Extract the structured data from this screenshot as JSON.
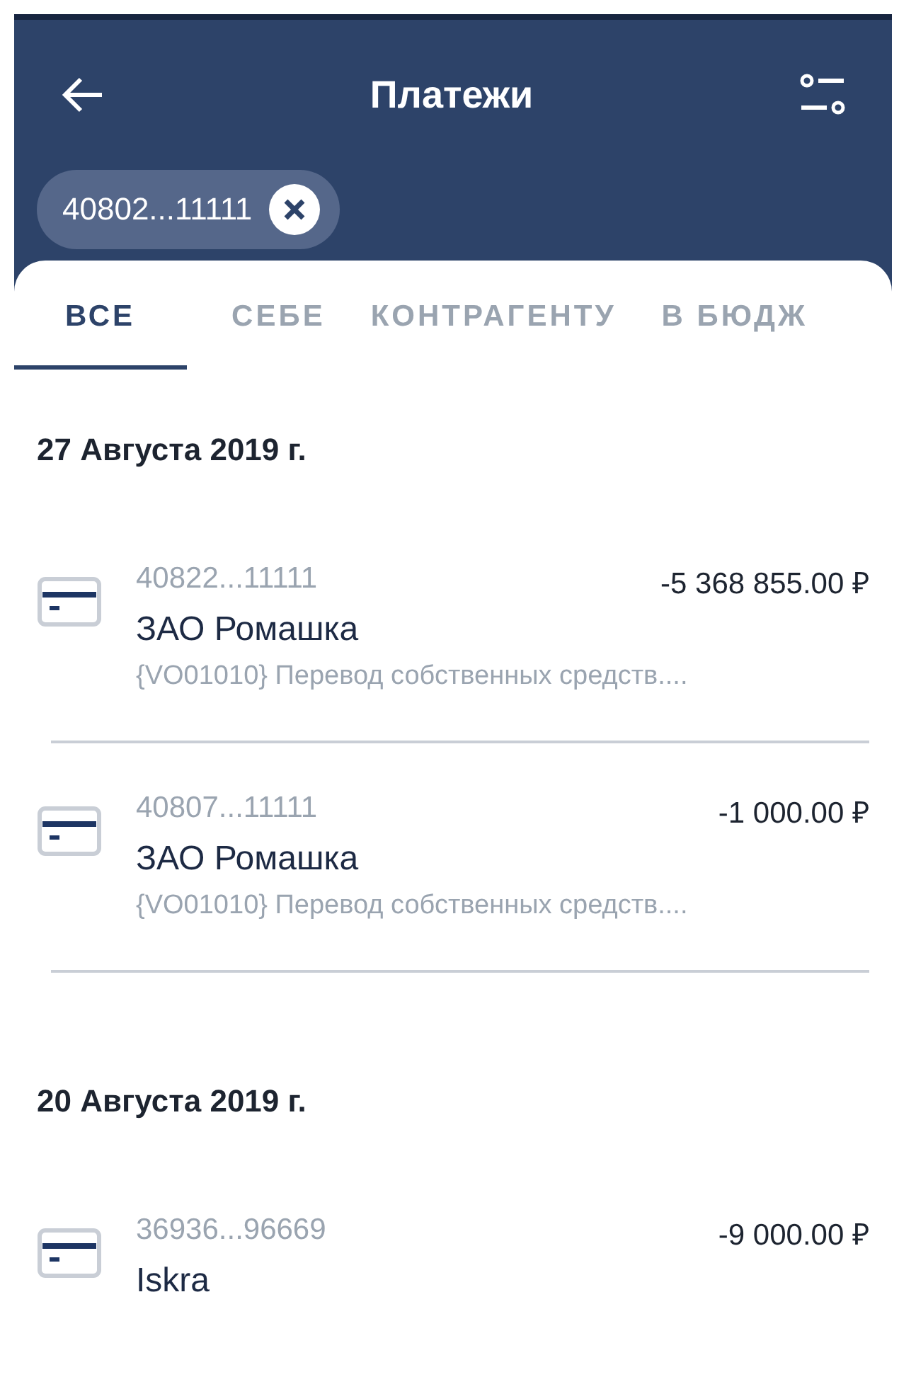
{
  "header": {
    "title": "Платежи"
  },
  "filter_chip": {
    "label": "40802...11111"
  },
  "tabs": [
    {
      "label": "ВСЕ",
      "selected": true
    },
    {
      "label": "СЕБЕ",
      "selected": false
    },
    {
      "label": "КОНТРАГЕНТУ",
      "selected": false
    },
    {
      "label": "В БЮДЖ",
      "selected": false
    }
  ],
  "groups": [
    {
      "date": "27 Августа 2019 г.",
      "payments": [
        {
          "account": "40822...11111",
          "amount": "-5 368 855.00 ₽",
          "name": "ЗАО Ромашка",
          "purpose": "{VO01010} Перевод собственных средств...."
        },
        {
          "account": "40807...11111",
          "amount": "-1 000.00 ₽",
          "name": "ЗАО Ромашка",
          "purpose": "{VO01010} Перевод собственных средств...."
        }
      ]
    },
    {
      "date": "20 Августа 2019 г.",
      "payments": [
        {
          "account": "36936...96669",
          "amount": "-9 000.00 ₽",
          "name": "Iskra"
        }
      ]
    }
  ]
}
